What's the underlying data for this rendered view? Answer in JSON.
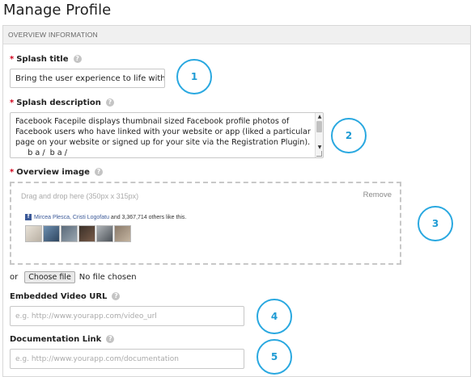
{
  "page": {
    "title": "Manage Profile"
  },
  "panel": {
    "header": "OVERVIEW INFORMATION"
  },
  "fields": {
    "splash_title": {
      "label": "Splash title",
      "required": "*",
      "help": "?",
      "value": "Bring the user experience to life with Fac"
    },
    "splash_description": {
      "label": "Splash description",
      "required": "*",
      "help": "?",
      "value": "Facebook Facepile displays thumbnail sized Facebook profile photos of Facebook users who have linked with your website or app (liked a particular page on your website or signed up for your site via the Registration Plugin).      b a /  b a /"
    },
    "overview_image": {
      "label": "Overview image",
      "required": "*",
      "help": "?",
      "dropzone_hint": "Drag and drop here (350px x 315px)",
      "remove_label": "Remove",
      "preview": {
        "fb_icon": "f",
        "names": "Mircea Plesca, Cristi Logofatu",
        "others_text": " and 3,367,714 others like this."
      }
    },
    "file_input": {
      "or_label": "or",
      "button_label": "Choose file",
      "status": "No file chosen"
    },
    "video_url": {
      "label": "Embedded Video URL",
      "help": "?",
      "placeholder": "e.g. http://www.yourapp.com/video_url"
    },
    "documentation_link": {
      "label": "Documentation Link",
      "help": "?",
      "placeholder": "e.g. http://www.yourapp.com/documentation"
    }
  },
  "badges": [
    "1",
    "2",
    "3",
    "4",
    "5"
  ],
  "colors": {
    "accent": "#29a8e0",
    "required": "#d0021b",
    "facebook": "#3b5998"
  }
}
